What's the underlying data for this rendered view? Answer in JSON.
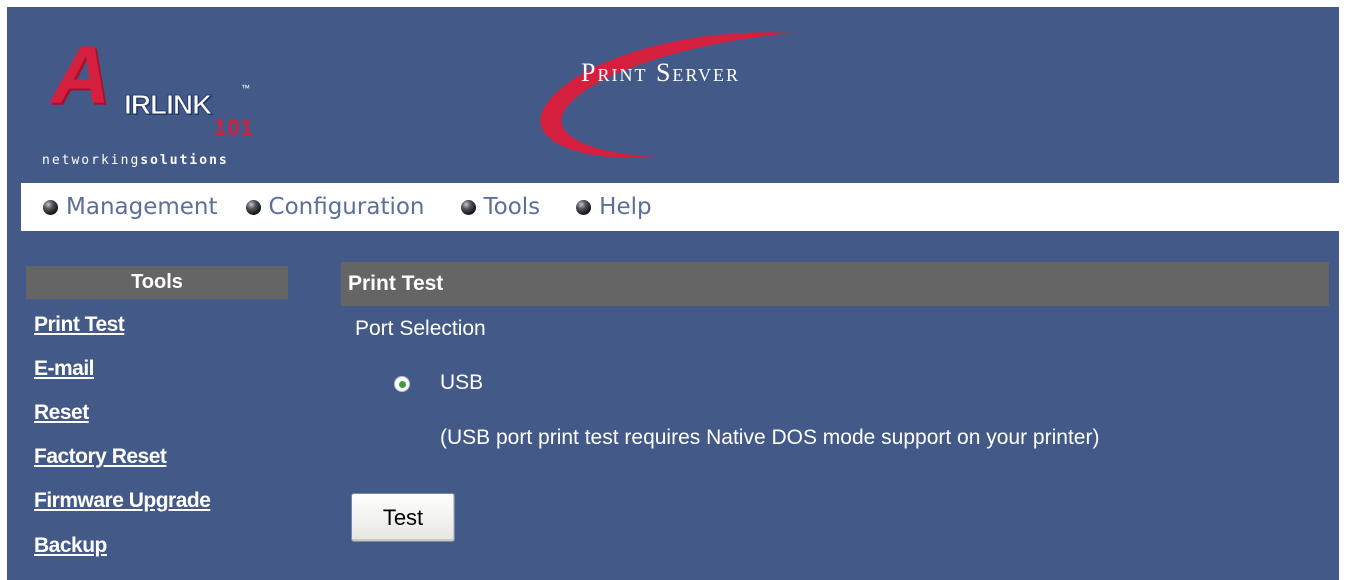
{
  "header": {
    "logo_letter": "A",
    "logo_wordmark": "IRLINK",
    "logo_tm": "™",
    "logo_number": "101",
    "tagline_light": "networking",
    "tagline_bold": "solutions",
    "product_title": "Print Server"
  },
  "nav": {
    "items": [
      {
        "label": "Management"
      },
      {
        "label": "Configuration"
      },
      {
        "label": "Tools"
      },
      {
        "label": "Help"
      }
    ]
  },
  "sidebar": {
    "title": "Tools",
    "links": [
      {
        "label": "Print Test"
      },
      {
        "label": "E-mail"
      },
      {
        "label": "Reset"
      },
      {
        "label": "Factory Reset"
      },
      {
        "label": "Firmware Upgrade"
      },
      {
        "label": "Backup"
      }
    ]
  },
  "main": {
    "section_title": "Print Test",
    "port_selection_label": "Port Selection",
    "port_option": "USB",
    "port_selected": true,
    "note": "(USB port print test requires Native DOS mode support on your printer)",
    "test_button_label": "Test"
  },
  "colors": {
    "background": "#435a88",
    "nav_bar": "#ffffff",
    "section_header": "#656565",
    "brand_red": "#d51f3e"
  }
}
